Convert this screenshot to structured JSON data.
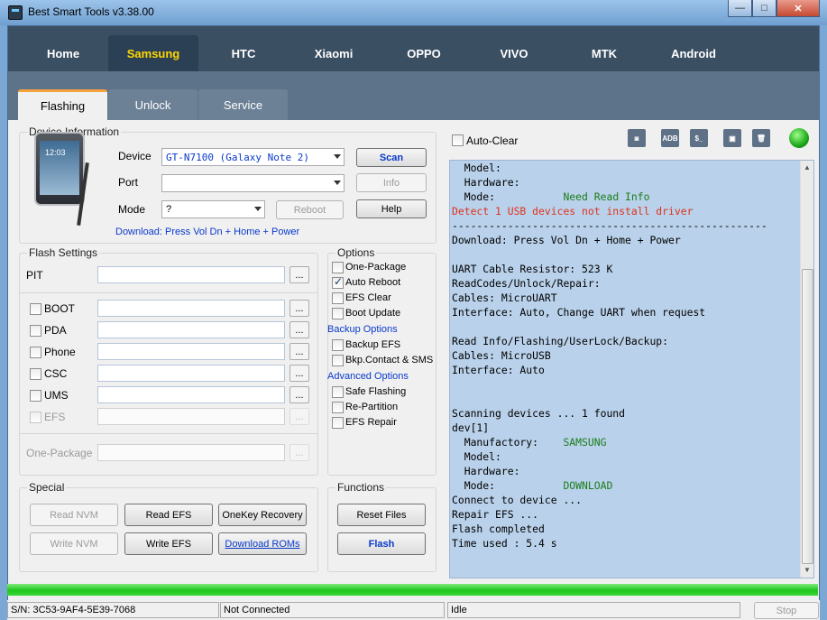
{
  "window": {
    "title": "Best Smart Tools v3.38.00",
    "min": "—",
    "max": "□",
    "close": "✕"
  },
  "main_tabs": [
    "Home",
    "Samsung",
    "HTC",
    "Xiaomi",
    "OPPO",
    "VIVO",
    "MTK",
    "Android"
  ],
  "active_main_tab": "Samsung",
  "sub_tabs": [
    "Flashing",
    "Unlock",
    "Service"
  ],
  "active_sub_tab": "Flashing",
  "device_info": {
    "legend": "Device Information",
    "device_label": "Device",
    "device_value": "GT-N7100  (Galaxy Note 2)",
    "port_label": "Port",
    "port_value": "",
    "mode_label": "Mode",
    "mode_value": "?",
    "scan": "Scan",
    "info": "Info",
    "reboot": "Reboot",
    "help": "Help",
    "hint": "Download: Press Vol Dn + Home + Power",
    "phone_time": "12:03"
  },
  "flash_settings": {
    "legend": "Flash Settings",
    "pit": "PIT",
    "items": [
      "BOOT",
      "PDA",
      "Phone",
      "CSC",
      "UMS",
      "EFS"
    ],
    "one_package": "One-Package",
    "browse": "..."
  },
  "options": {
    "legend": "Options",
    "items": [
      {
        "label": "One-Package",
        "checked": false
      },
      {
        "label": "Auto Reboot",
        "checked": true
      },
      {
        "label": "EFS Clear",
        "checked": false
      },
      {
        "label": "Boot Update",
        "checked": false
      }
    ],
    "backup_head": "Backup Options",
    "backup": [
      {
        "label": "Backup EFS",
        "checked": false
      },
      {
        "label": "Bkp.Contact & SMS",
        "checked": false
      }
    ],
    "advanced_head": "Advanced Options",
    "advanced": [
      {
        "label": "Safe Flashing",
        "checked": false
      },
      {
        "label": "Re-Partition",
        "checked": false
      },
      {
        "label": "EFS Repair",
        "checked": false
      }
    ]
  },
  "special": {
    "legend": "Special",
    "read_nvm": "Read NVM",
    "read_efs": "Read EFS",
    "onekey": "OneKey Recovery",
    "write_nvm": "Write NVM",
    "write_efs": "Write EFS",
    "download_roms": "Download ROMs"
  },
  "functions": {
    "legend": "Functions",
    "reset_files": "Reset Files",
    "flash": "Flash"
  },
  "log_toolbar": {
    "auto_clear": "Auto-Clear",
    "adb": "ADB",
    "shell": "$_"
  },
  "log": [
    {
      "t": "  Model:",
      "c": "#000"
    },
    {
      "t": "  Hardware:",
      "c": "#000"
    },
    {
      "t": "  Mode:           ",
      "c": "#000",
      "t2": "Need Read Info",
      "c2": "#1a7d1a"
    },
    {
      "t": "Detect 1 USB devices not install driver",
      "c": "#e0321c"
    },
    {
      "t": "---------------------------------------------------",
      "c": "#000"
    },
    {
      "t": "Download: Press Vol Dn + Home + Power",
      "c": "#000"
    },
    {
      "t": "",
      "c": "#000"
    },
    {
      "t": "UART Cable Resistor: 523 K",
      "c": "#000"
    },
    {
      "t": "ReadCodes/Unlock/Repair:",
      "c": "#000"
    },
    {
      "t": "Cables: MicroUART",
      "c": "#000"
    },
    {
      "t": "Interface: Auto, Change UART when request",
      "c": "#000"
    },
    {
      "t": "",
      "c": "#000"
    },
    {
      "t": "Read Info/Flashing/UserLock/Backup:",
      "c": "#000"
    },
    {
      "t": "Cables: MicroUSB",
      "c": "#000"
    },
    {
      "t": "Interface: Auto",
      "c": "#000"
    },
    {
      "t": "",
      "c": "#000"
    },
    {
      "t": "",
      "c": "#000"
    },
    {
      "t": "Scanning devices ... 1 found",
      "c": "#000"
    },
    {
      "t": "dev[1]",
      "c": "#000"
    },
    {
      "t": "  Manufactory:    ",
      "c": "#000",
      "t2": "SAMSUNG",
      "c2": "#1a7d1a"
    },
    {
      "t": "  Model:",
      "c": "#000"
    },
    {
      "t": "  Hardware:",
      "c": "#000"
    },
    {
      "t": "  Mode:           ",
      "c": "#000",
      "t2": "DOWNLOAD",
      "c2": "#1a7d1a"
    },
    {
      "t": "Connect to device ...",
      "c": "#000"
    },
    {
      "t": "Repair EFS ...",
      "c": "#000"
    },
    {
      "t": "Flash completed",
      "c": "#000"
    },
    {
      "t": "Time used : 5.4 s",
      "c": "#000"
    }
  ],
  "progress_percent": 100,
  "status": {
    "sn": "S/N: 3C53-9AF4-5E39-7068",
    "connection": "Not Connected",
    "state": "Idle",
    "stop": "Stop"
  }
}
